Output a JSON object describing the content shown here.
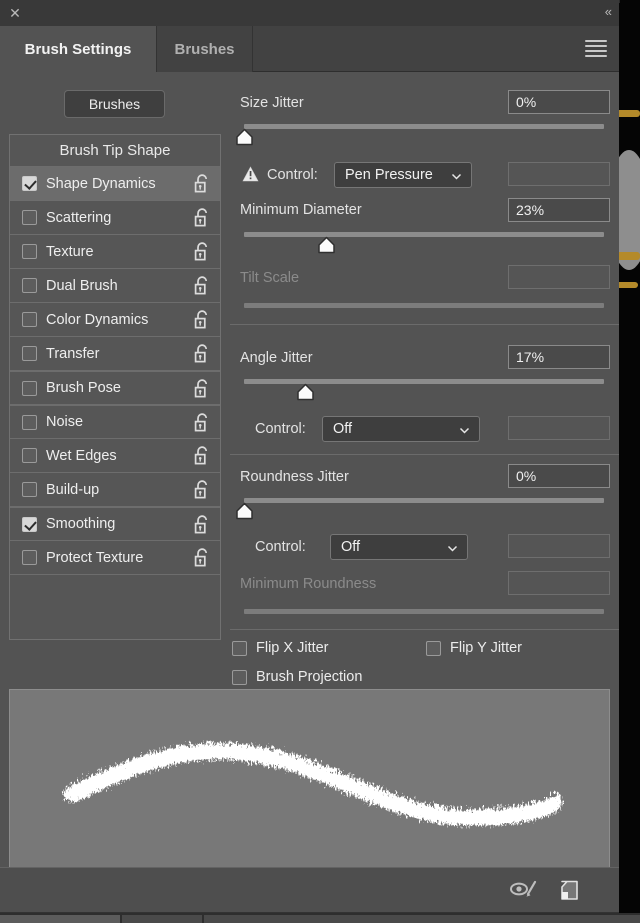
{
  "window": {
    "close_label": "✕",
    "collapse_label": "«"
  },
  "tabs": [
    {
      "label": "Brush Settings",
      "active": true
    },
    {
      "label": "Brushes",
      "active": false
    }
  ],
  "menu_icon": "hamburger-menu-icon",
  "sidebar": {
    "brushes_button": "Brushes",
    "header": "Brush Tip Shape",
    "items": [
      {
        "label": "Shape Dynamics",
        "checked": true,
        "selected": true,
        "lock": "unlocked"
      },
      {
        "label": "Scattering",
        "checked": false,
        "selected": false,
        "lock": "unlocked"
      },
      {
        "label": "Texture",
        "checked": false,
        "selected": false,
        "lock": "unlocked"
      },
      {
        "label": "Dual Brush",
        "checked": false,
        "selected": false,
        "lock": "unlocked"
      },
      {
        "label": "Color Dynamics",
        "checked": false,
        "selected": false,
        "lock": "unlocked"
      },
      {
        "label": "Transfer",
        "checked": false,
        "selected": false,
        "lock": "unlocked"
      },
      {
        "label": "Brush Pose",
        "checked": false,
        "selected": false,
        "lock": "unlocked"
      },
      {
        "label": "Noise",
        "checked": false,
        "selected": false,
        "lock": "unlocked"
      },
      {
        "label": "Wet Edges",
        "checked": false,
        "selected": false,
        "lock": "unlocked"
      },
      {
        "label": "Build-up",
        "checked": false,
        "selected": false,
        "lock": "unlocked"
      },
      {
        "label": "Smoothing",
        "checked": true,
        "selected": false,
        "lock": "unlocked"
      },
      {
        "label": "Protect Texture",
        "checked": false,
        "selected": false,
        "lock": "unlocked"
      }
    ]
  },
  "settings": {
    "size_jitter": {
      "label": "Size Jitter",
      "value": "0%",
      "slider_percent": 0,
      "control_label": "Control:",
      "control_value": "Pen Pressure",
      "control_warning": true,
      "control_extra_value": ""
    },
    "minimum_diameter": {
      "label": "Minimum Diameter",
      "value": "23%",
      "slider_percent": 23
    },
    "tilt_scale": {
      "label": "Tilt Scale",
      "value": "",
      "slider_percent": 0,
      "disabled": true
    },
    "angle_jitter": {
      "label": "Angle Jitter",
      "value": "17%",
      "slider_percent": 17,
      "control_label": "Control:",
      "control_value": "Off",
      "control_extra_value": ""
    },
    "roundness_jitter": {
      "label": "Roundness Jitter",
      "value": "0%",
      "slider_percent": 0,
      "control_label": "Control:",
      "control_value": "Off",
      "control_extra_value": ""
    },
    "minimum_roundness": {
      "label": "Minimum Roundness",
      "value": "",
      "slider_percent": 0,
      "disabled": true
    },
    "flip_x_jitter": {
      "label": "Flip X Jitter",
      "checked": false
    },
    "flip_y_jitter": {
      "label": "Flip Y Jitter",
      "checked": false
    },
    "brush_projection": {
      "label": "Brush Projection",
      "checked": false
    }
  },
  "preview": {
    "name": "brush-stroke-preview"
  },
  "bottom_bar": {
    "icons": [
      {
        "name": "toggle-live-tip-brush-preview-icon"
      },
      {
        "name": "create-new-brush-icon"
      }
    ]
  },
  "colors": {
    "panel_bg": "#535353",
    "tabbar_bg": "#424242",
    "active_tab_bg": "#535353",
    "title_bg": "#393939",
    "list_bg": "#565656",
    "selected_row": "#6c6c6c",
    "value_box_bg": "#4a4a4a",
    "dropdown_bg": "#3e3e3e",
    "track": "#8c8c8c",
    "text": "#eeeeee",
    "text_dim": "#8b8b8b",
    "preview_bg": "#787878",
    "stroke": "#ffffff"
  }
}
